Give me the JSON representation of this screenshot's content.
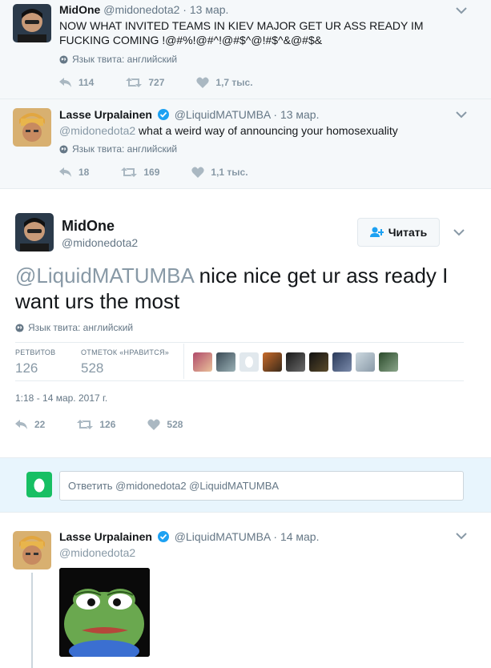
{
  "tweets": [
    {
      "name": "MidOne",
      "handle": "@midonedota2",
      "date": "13 мар.",
      "text": "NOW WHAT INVITED TEAMS IN KIEV MAJOR GET UR ASS READY IM FUCKING COMING !@#%!@#^!@#$^@!#$^&@#$&",
      "lang": "Язык твита: английский",
      "replies": "114",
      "retweets": "727",
      "likes": "1,7 тыс."
    },
    {
      "name": "Lasse Urpalainen",
      "handle": "@LiquidMATUMBA",
      "date": "13 мар.",
      "reply_to": "@midonedota2",
      "text": " what a weird way of announcing your homosexuality",
      "lang": "Язык твита: английский",
      "replies": "18",
      "retweets": "169",
      "likes": "1,1 тыс."
    }
  ],
  "main": {
    "name": "MidOne",
    "handle": "@midonedota2",
    "follow_label": "Читать",
    "mention": "@LiquidMATUMBA",
    "text": " nice nice get ur ass ready I want urs the most",
    "lang": "Язык твита: английский",
    "retweets_label": "РЕТВИТОВ",
    "retweets": "126",
    "likes_label": "ОТМЕТОК «НРАВИТСЯ»",
    "likes": "528",
    "timestamp": "1:18 - 14 мар. 2017 г.",
    "replies": "22",
    "action_retweets": "126",
    "action_likes": "528"
  },
  "reply_box": {
    "placeholder": "Ответить @midonedota2 @LiquidMATUMBA"
  },
  "reply": {
    "name": "Lasse Urpalainen",
    "handle": "@LiquidMATUMBA",
    "date": "14 мар.",
    "to": "@midonedota2"
  },
  "colors": {
    "accent": "#1da1f2",
    "verified": "#1da1f2",
    "muted": "#657786"
  }
}
